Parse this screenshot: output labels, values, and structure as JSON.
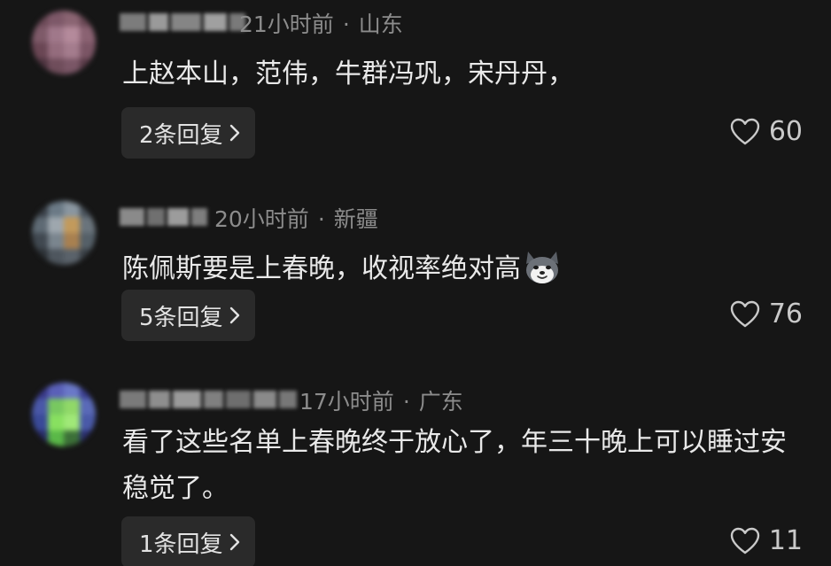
{
  "comments": [
    {
      "time": "21小时前",
      "location": "山东",
      "text": "上赵本山，范伟，牛群冯巩，宋丹丹，",
      "replies": "2条回复",
      "likes": "60"
    },
    {
      "time": "20小时前",
      "location": "新疆",
      "text": "陈佩斯要是上春晚，收视率绝对高",
      "emoji": "husky-dog-emoji",
      "replies": "5条回复",
      "likes": "76"
    },
    {
      "time": "17小时前",
      "location": "广东",
      "text": "看了这些名单上春晚终于放心了，年三十晚上可以睡过安稳觉了。",
      "replies": "1条回复",
      "likes": "11"
    }
  ],
  "icons": {
    "like": "heart-icon",
    "reply_chevron": "chevron-right-icon"
  },
  "colors": {
    "background": "#161616",
    "text": "#e9e9e9",
    "meta": "#8c8c8c",
    "reply_bg": "#2a2a2a"
  }
}
